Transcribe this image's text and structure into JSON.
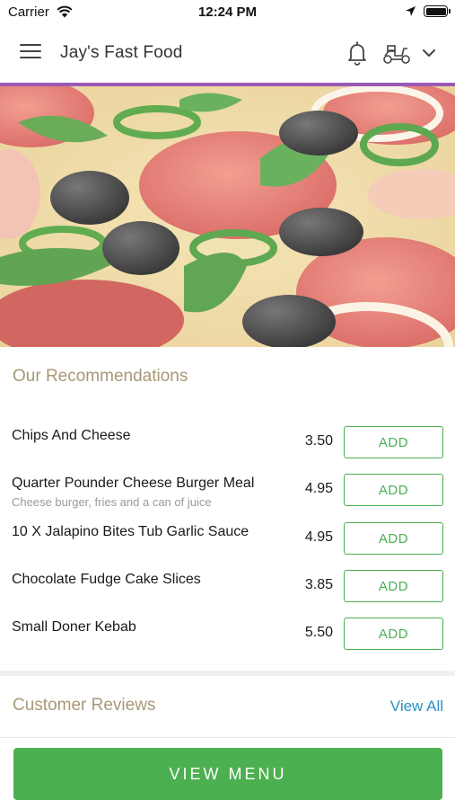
{
  "status_bar": {
    "carrier": "Carrier",
    "time": "12:24 PM"
  },
  "header": {
    "title": "Jay's Fast Food",
    "icons": [
      "menu-icon",
      "bell-icon",
      "scooter-icon",
      "chevron-down-icon"
    ]
  },
  "hero": {
    "image": "pizza-image"
  },
  "recommendations": {
    "title": "Our Recommendations",
    "add_label": "ADD",
    "items": [
      {
        "name": "Chips And Cheese",
        "description": "",
        "price": "3.50"
      },
      {
        "name": "Quarter Pounder Cheese Burger Meal",
        "description": "Cheese burger, fries and a can of juice",
        "price": "4.95"
      },
      {
        "name": "10 X Jalapino Bites Tub Garlic Sauce",
        "description": "",
        "price": "4.95"
      },
      {
        "name": "Chocolate Fudge Cake Slices",
        "description": "",
        "price": "3.85"
      },
      {
        "name": "Small Doner Kebab",
        "description": "",
        "price": "5.50"
      }
    ]
  },
  "reviews": {
    "title": "Customer Reviews",
    "view_all_label": "View All"
  },
  "cta": {
    "label": "VIEW MENU"
  },
  "colors": {
    "accent_line": "#9b59b6",
    "section_title": "#a89878",
    "add_button": "#4caf50",
    "cta_background": "#4caf50",
    "link": "#2a8fc1"
  }
}
